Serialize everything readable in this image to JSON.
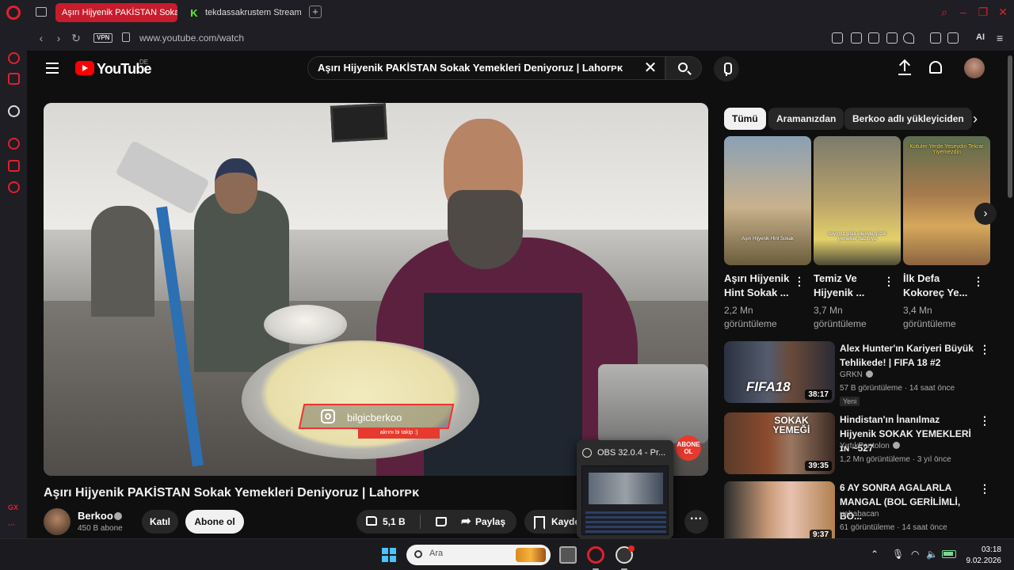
{
  "browser": {
    "tabs": [
      {
        "label": "Aşırı Hijyenik PAKİSTAN Sokak",
        "active": true
      },
      {
        "label": "tekdassakrustem Stream - ",
        "active": false
      }
    ],
    "new_tab_icon": "plus-icon",
    "url": "www.youtube.com/watch",
    "vpn_label": "VPN",
    "ai_label": "AI",
    "sidebar_text_label": "GX",
    "accent_color": "#e0202e"
  },
  "youtube": {
    "logo_text": "YouTube",
    "region": "DE",
    "search_query": "Aşırı Hijyenik PAKİSTAN Sokak Yemekleri Deniyoruz | Lahorᴘᴋ",
    "video": {
      "title": "Aşırı Hijyenik PAKİSTAN Sokak Yemekleri Deniyoruz | Lahorᴘᴋ",
      "overlay_handle": "bilgicberkoo",
      "overlay_follow": "akrını bi takip :)",
      "overlay_badge": "ABONE OL"
    },
    "channel": {
      "name": "Berkoo",
      "subscribers": "450 B abone",
      "join_label": "Katıl",
      "subscribe_label": "Abone ol"
    },
    "actions": {
      "likes": "5,1 B",
      "share_label": "Paylaş",
      "save_label": "Kaydet"
    },
    "chips": [
      "Tümü",
      "Aramanızdan",
      "Berkoo adlı yükleyiciden"
    ],
    "shorts": [
      {
        "title": "Aşırı Hijyenik Hint Sokak ...",
        "views": "2,2 Mn görüntüleme",
        "caption": "Aşırı Hijyenik Hint Sokak"
      },
      {
        "title": "Temiz Ve Hijyenik ...",
        "views": "3,7 Mn görüntüleme",
        "caption": "dayımız şifalı elleriyle güzel yemekler hazırlıyo"
      },
      {
        "title": "İlk Defa Kokoreç Ye...",
        "views": "3,4 Mn görüntüleme",
        "caption": "Kotuler Yerde Yeseydin Tekrar Yiyemezdin"
      }
    ],
    "recommended": [
      {
        "title": "Alex Hunter'ın Kariyeri Büyük Tehlikede! | FIFA 18 #2",
        "channel": "GRKN",
        "verified": true,
        "meta": "57 B görüntüleme · 14 saat önce",
        "badge": "Yeni",
        "duration": "38:17",
        "thumb_text": "FIFA18"
      },
      {
        "title": "Hindistan'ın İnanılmaz Hijyenik SOKAK YEMEKLERİ ɪɴ ~527",
        "channel": "YırtıkPantolon",
        "verified": true,
        "meta": "1,2 Mn görüntüleme · 3 yıl önce",
        "badge": "",
        "duration": "39:35",
        "thumb_text": "SOKAK YEMEĞİ"
      },
      {
        "title": "6 AY SONRA AGALARLA MANGAL (BOL GERİLİMLİ, BO...",
        "channel": "uebabacan",
        "verified": false,
        "meta": "61 görüntüleme · 14 saat önce",
        "badge": "",
        "duration": "9:37",
        "thumb_text": ""
      }
    ]
  },
  "obs_popup": {
    "title": "OBS 32.0.4 - Pr..."
  },
  "taskbar": {
    "search_placeholder": "Ara",
    "time": "03:18",
    "date": "9.02.2026"
  }
}
